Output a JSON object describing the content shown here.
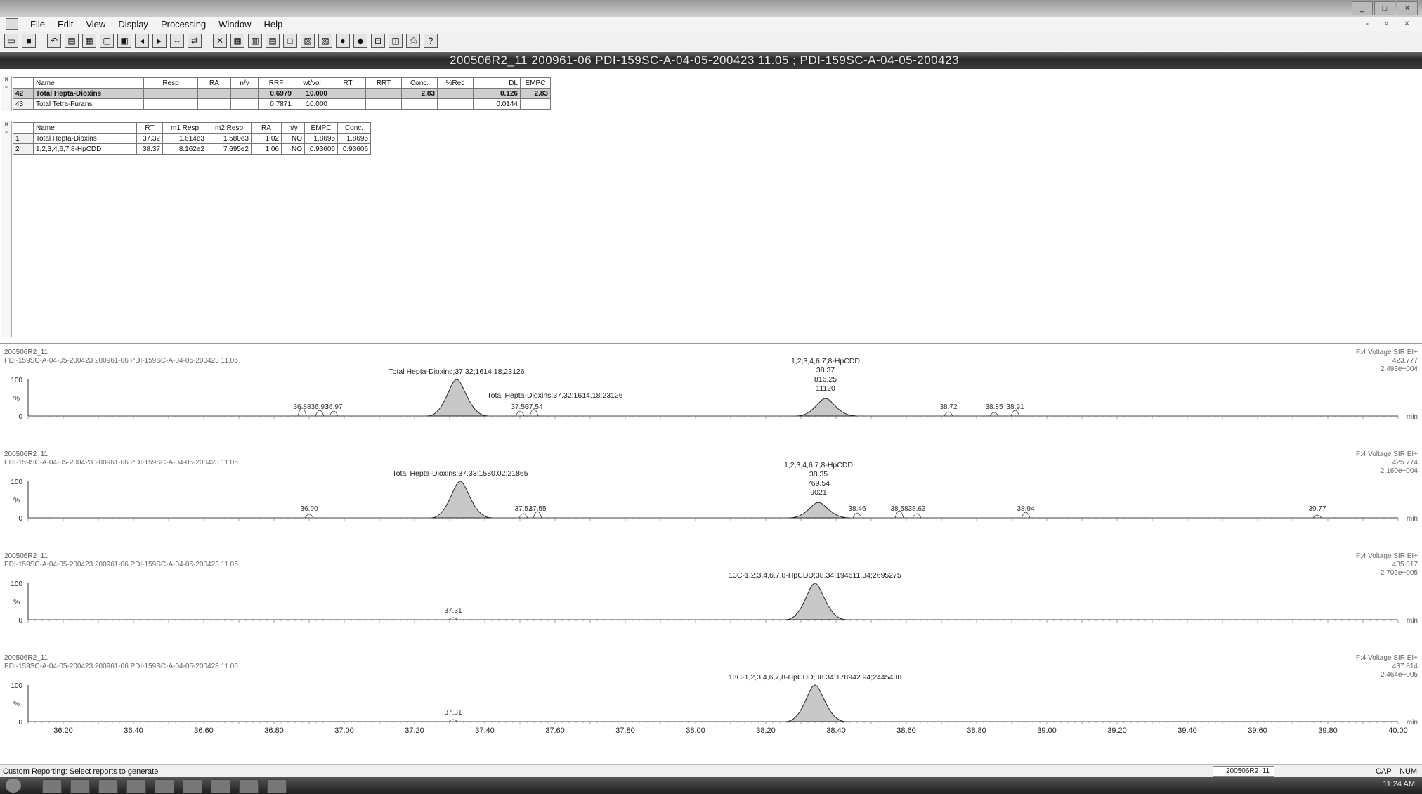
{
  "menu": [
    "File",
    "Edit",
    "View",
    "Display",
    "Processing",
    "Window",
    "Help"
  ],
  "doc_title": "200506R2_11 200961-06 PDI-159SC-A-04-05-200423 11.05 ; PDI-159SC-A-04-05-200423",
  "summary_table": {
    "headers": [
      "",
      "Name",
      "Resp",
      "RA",
      "n/y",
      "RRF",
      "wt/vol",
      "RT",
      "RRT",
      "Conc.",
      "%Rec",
      "DL",
      "EMPC"
    ],
    "rows": [
      [
        "42",
        "Total Hepta-Dioxins",
        "",
        "",
        "",
        "0.6979",
        "10.000",
        "",
        "",
        "2.83",
        "",
        "0.126",
        "2.83"
      ],
      [
        "43",
        "Total Tetra-Furans",
        "",
        "",
        "",
        "0.7871",
        "10.000",
        "",
        "",
        "",
        "",
        "0.0144",
        ""
      ]
    ]
  },
  "detail_table": {
    "headers": [
      "",
      "Name",
      "RT",
      "m1 Resp",
      "m2 Resp",
      "RA",
      "n/y",
      "EMPC",
      "Conc."
    ],
    "rows": [
      [
        "1",
        "Total Hepta-Dioxins",
        "37.32",
        "1.614e3",
        "1.580e3",
        "1.02",
        "NO",
        "1.8695",
        "1.8695"
      ],
      [
        "2",
        "1,2,3,4,6,7,8-HpCDD",
        "38.37",
        "8.162e2",
        "7.695e2",
        "1.06",
        "NO",
        "0.93606",
        "0.93606"
      ]
    ]
  },
  "chromatograms": [
    {
      "id": "200506R2_11",
      "sample": "PDI-159SC-A-04-05-200423 200961-06 PDI-159SC-A-04-05-200423 11.05",
      "right_header": "F:4 Voltage SIR EI+",
      "right_mass": "423.777",
      "right_intensity": "2.493e+004",
      "labels": {
        "peak1": "Total Hepta-Dioxins;37.32;1614.18;23126",
        "peak1b": "Total Hepta-Dioxins;37.32;1614.18;23126",
        "peak2_name": "1,2,3,4,6,7,8-HpCDD",
        "peak2_rt": "38.37",
        "peak2_area": "816.25",
        "peak2_height": "11120",
        "minor": [
          "36.88",
          "36.93",
          "36.97",
          "37.50",
          "37.54",
          "38.72",
          "38.85",
          "38.91"
        ]
      }
    },
    {
      "id": "200506R2_11",
      "sample": "PDI-159SC-A-04-05-200423 200961-06 PDI-159SC-A-04-05-200423 11.05",
      "right_header": "F:4 Voltage SIR EI+",
      "right_mass": "425.774",
      "right_intensity": "2.160e+004",
      "labels": {
        "peak1": "Total Hepta-Dioxins;37.33;1580.02;21865",
        "peak2_name": "1,2,3,4,6,7,8-HpCDD",
        "peak2_rt": "38.35",
        "peak2_area": "769.54",
        "peak2_height": "9021",
        "minor": [
          "36.90",
          "37.51",
          "37.55",
          "38.46",
          "38.58",
          "38.63",
          "38.94",
          "39.77"
        ]
      }
    },
    {
      "id": "200506R2_11",
      "sample": "PDI-159SC-A-04-05-200423 200961-06 PDI-159SC-A-04-05-200423 11.05",
      "right_header": "F:4 Voltage SIR EI+",
      "right_mass": "435.817",
      "right_intensity": "2.702e+005",
      "labels": {
        "peak_main": "13C-1,2,3,4,6,7,8-HpCDD;38.34;194611.34;2695275",
        "minor": [
          "37.31"
        ]
      }
    },
    {
      "id": "200506R2_11",
      "sample": "PDI-159SC-A-04-05-200423 200961-06 PDI-159SC-A-04-05-200423 11.05",
      "right_header": "F:4 Voltage SIR EI+",
      "right_mass": "437.814",
      "right_intensity": "2.464e+005",
      "labels": {
        "peak_main": "13C-1,2,3,4,6,7,8-HpCDD;38.34;178942.94;2445408",
        "minor": [
          "37.31"
        ]
      }
    }
  ],
  "y_axis": {
    "top": "100",
    "mid": "%",
    "bottom": "0",
    "unit": "min"
  },
  "x_axis_ticks": [
    "36.20",
    "36.40",
    "36.60",
    "36.80",
    "37.00",
    "37.20",
    "37.40",
    "37.60",
    "37.80",
    "38.00",
    "38.20",
    "38.40",
    "38.60",
    "38.80",
    "39.00",
    "39.20",
    "39.40",
    "39.60",
    "39.80",
    "40.00"
  ],
  "chart_data": [
    {
      "type": "line",
      "title": "",
      "xlabel": "",
      "ylabel": "",
      "xlim": [
        36.1,
        40.0
      ],
      "ylim": [
        0,
        100
      ],
      "peaks": [
        {
          "name": "Total Hepta-Dioxins",
          "rt": 37.32,
          "height_pct": 100
        },
        {
          "name": "1,2,3,4,6,7,8-HpCDD",
          "rt": 38.37,
          "height_pct": 48
        }
      ]
    },
    {
      "type": "line",
      "title": "",
      "xlabel": "",
      "ylabel": "",
      "xlim": [
        36.1,
        40.0
      ],
      "ylim": [
        0,
        100
      ],
      "peaks": [
        {
          "name": "Total Hepta-Dioxins",
          "rt": 37.33,
          "height_pct": 100
        },
        {
          "name": "1,2,3,4,6,7,8-HpCDD",
          "rt": 38.35,
          "height_pct": 42
        }
      ]
    },
    {
      "type": "line",
      "title": "",
      "xlabel": "",
      "ylabel": "",
      "xlim": [
        36.1,
        40.0
      ],
      "ylim": [
        0,
        100
      ],
      "peaks": [
        {
          "name": "13C-1,2,3,4,6,7,8-HpCDD",
          "rt": 38.34,
          "height_pct": 100
        }
      ]
    },
    {
      "type": "line",
      "title": "",
      "xlabel": "",
      "ylabel": "",
      "xlim": [
        36.1,
        40.0
      ],
      "ylim": [
        0,
        100
      ],
      "peaks": [
        {
          "name": "13C-1,2,3,4,6,7,8-HpCDD",
          "rt": 38.34,
          "height_pct": 100
        }
      ]
    }
  ],
  "status": {
    "message": "Custom Reporting: Select reports to generate",
    "file": "200506R2_11",
    "cap": "CAP",
    "num": "NUM"
  },
  "taskbar_clock": "11:24 AM"
}
